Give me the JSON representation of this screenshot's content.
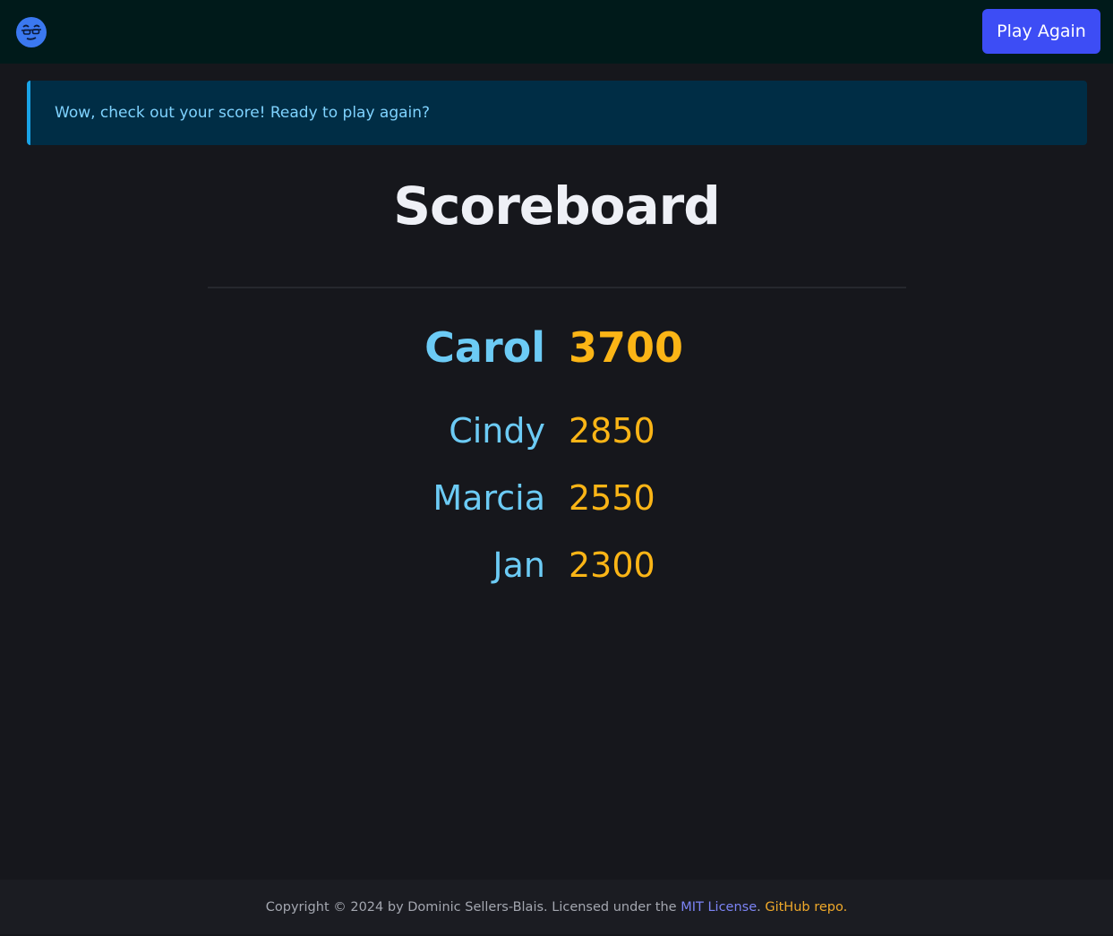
{
  "header": {
    "logo_icon": "face-logo-icon",
    "play_again_label": "Play Again",
    "accent_color": "#3d4df5"
  },
  "alert": {
    "message": "Wow, check out your score! Ready to play again?"
  },
  "scoreboard": {
    "title": "Scoreboard",
    "entries": [
      {
        "name": "Carol",
        "score": "3700"
      },
      {
        "name": "Cindy",
        "score": "2850"
      },
      {
        "name": "Marcia",
        "score": "2550"
      },
      {
        "name": "Jan",
        "score": "2300"
      }
    ],
    "name_color": "#6ccbf5",
    "score_color": "#fbb516"
  },
  "footer": {
    "copyright_text": "Copyright © 2024 by Dominic Sellers-Blais. Licensed under the ",
    "license_link": "MIT License",
    "separator": ". ",
    "repo_link": "GitHub repo."
  }
}
